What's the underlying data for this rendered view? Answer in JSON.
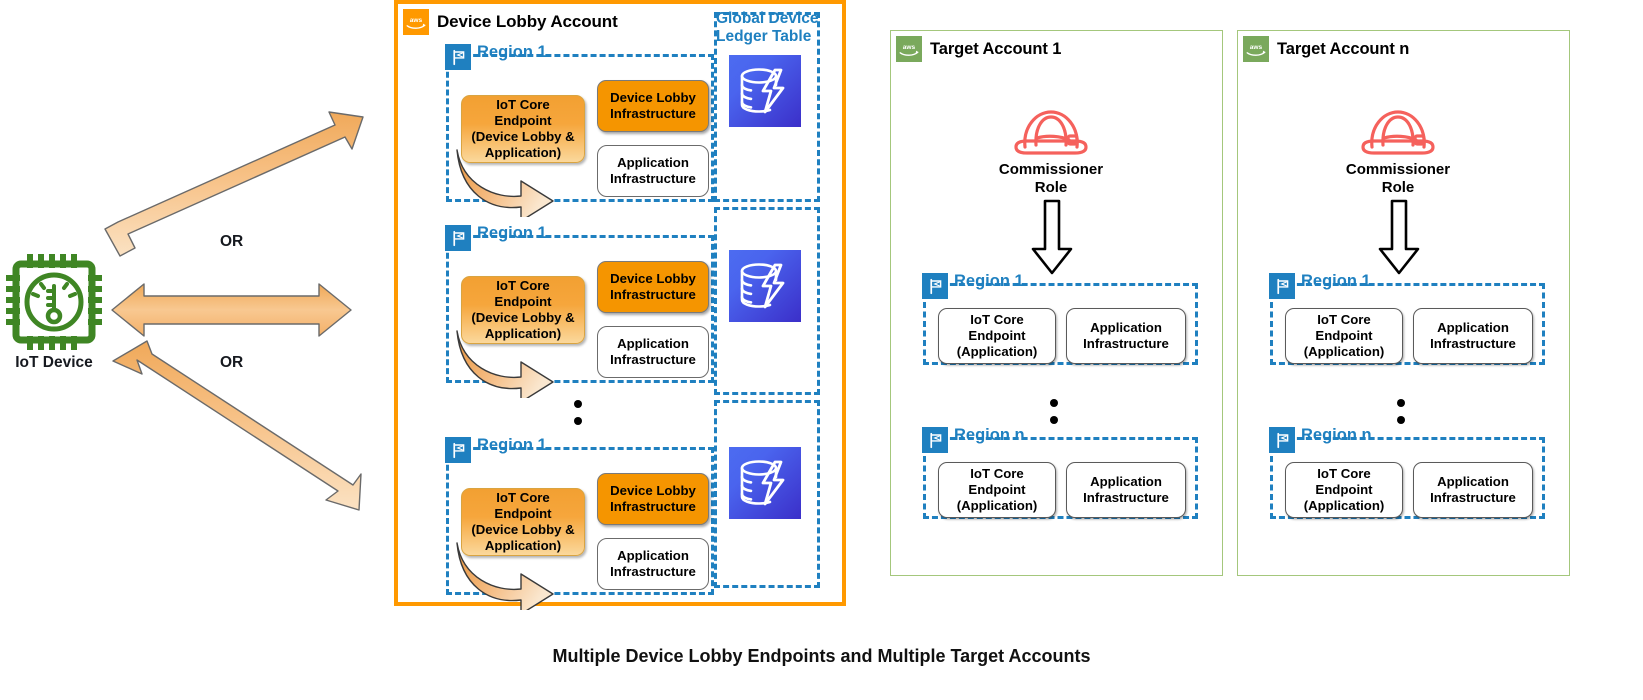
{
  "caption": "Multiple Device Lobby Endpoints and Multiple Target Accounts",
  "colors": {
    "aws_orange": "#ff9900",
    "aws_green": "#7aa95c",
    "region_blue": "#1f80c0",
    "iot_green": "#3f8624",
    "commissioner_red": "#f5615c",
    "dynamodb_blue": "#4c6cf0",
    "node_orange": "#f59500"
  },
  "device": {
    "icon": "iot-sensor-icon",
    "label": "IoT Device"
  },
  "connectors": [
    {
      "name": "device-to-lobby-top",
      "or_label": ""
    },
    {
      "name": "device-to-lobby-middle",
      "or_label": "OR"
    },
    {
      "name": "device-to-lobby-bottom",
      "or_label": "OR"
    }
  ],
  "or_labels": [
    "OR",
    "OR"
  ],
  "lobby_account": {
    "icon": "aws-account-icon",
    "title": "Device Lobby Account",
    "ledger": {
      "label_line1": "Global Device",
      "label_line2": "Ledger Table",
      "icon": "dynamodb-global-table-icon"
    },
    "regions": [
      {
        "name": "Region 1",
        "icon": "region-flag-icon",
        "endpoint": "IoT Core Endpoint (Device Lobby & Application)",
        "endpoint_lines": [
          "IoT Core",
          "Endpoint",
          "(Device Lobby &",
          "Application)"
        ],
        "lobby_infra": "Device Lobby Infrastructure",
        "lobby_infra_lines": [
          "Device Lobby",
          "Infrastructure"
        ],
        "app_infra": "Application Infrastructure",
        "app_infra_lines": [
          "Application",
          "Infrastructure"
        ]
      },
      {
        "name": "Region 1",
        "icon": "region-flag-icon",
        "endpoint": "IoT Core Endpoint (Device Lobby & Application)",
        "endpoint_lines": [
          "IoT Core",
          "Endpoint",
          "(Device Lobby &",
          "Application)"
        ],
        "lobby_infra": "Device Lobby Infrastructure",
        "lobby_infra_lines": [
          "Device Lobby",
          "Infrastructure"
        ],
        "app_infra": "Application Infrastructure",
        "app_infra_lines": [
          "Application",
          "Infrastructure"
        ]
      },
      {
        "name": "Region 1",
        "icon": "region-flag-icon",
        "endpoint": "IoT Core Endpoint (Device Lobby & Application)",
        "endpoint_lines": [
          "IoT Core",
          "Endpoint",
          "(Device Lobby &",
          "Application)"
        ],
        "lobby_infra": "Device Lobby Infrastructure",
        "lobby_infra_lines": [
          "Device Lobby",
          "Infrastructure"
        ],
        "app_infra": "Application Infrastructure",
        "app_infra_lines": [
          "Application",
          "Infrastructure"
        ]
      }
    ]
  },
  "target_accounts": [
    {
      "icon": "aws-account-icon",
      "title": "Target Account 1",
      "role": {
        "icon": "commissioner-hardhat-icon",
        "label_line1": "Commissioner",
        "label_line2": "Role"
      },
      "regions": [
        {
          "name": "Region 1",
          "icon": "region-flag-icon",
          "endpoint_lines": [
            "IoT Core",
            "Endpoint",
            "(Application)"
          ],
          "app_infra_lines": [
            "Application",
            "Infrastructure"
          ]
        },
        {
          "name": "Region n",
          "icon": "region-flag-icon",
          "endpoint_lines": [
            "IoT Core",
            "Endpoint",
            "(Application)"
          ],
          "app_infra_lines": [
            "Application",
            "Infrastructure"
          ]
        }
      ]
    },
    {
      "icon": "aws-account-icon",
      "title": "Target Account n",
      "role": {
        "icon": "commissioner-hardhat-icon",
        "label_line1": "Commissioner",
        "label_line2": "Role"
      },
      "regions": [
        {
          "name": "Region 1",
          "icon": "region-flag-icon",
          "endpoint_lines": [
            "IoT Core",
            "Endpoint",
            "(Application)"
          ],
          "app_infra_lines": [
            "Application",
            "Infrastructure"
          ]
        },
        {
          "name": "Region n",
          "icon": "region-flag-icon",
          "endpoint_lines": [
            "IoT Core",
            "Endpoint",
            "(Application)"
          ],
          "app_infra_lines": [
            "Application",
            "Infrastructure"
          ]
        }
      ]
    }
  ]
}
